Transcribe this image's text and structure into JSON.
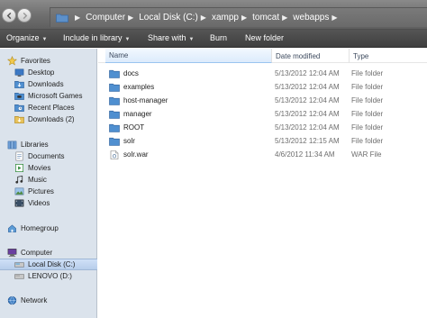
{
  "address_bar": {
    "breadcrumbs": [
      "Computer",
      "Local Disk (C:)",
      "xampp",
      "tomcat",
      "webapps"
    ]
  },
  "command_bar": {
    "organize": "Organize",
    "include_in_library": "Include in library",
    "share_with": "Share with",
    "burn": "Burn",
    "new_folder": "New folder"
  },
  "nav": {
    "favorites": {
      "label": "Favorites",
      "items": [
        "Desktop",
        "Downloads",
        "Microsoft Games",
        "Recent Places",
        "Downloads (2)"
      ]
    },
    "libraries": {
      "label": "Libraries",
      "items": [
        "Documents",
        "Movies",
        "Music",
        "Pictures",
        "Videos"
      ]
    },
    "homegroup": "Homegroup",
    "computer": {
      "label": "Computer",
      "items": [
        "Local Disk (C:)",
        "LENOVO (D:)"
      ],
      "selected": "Local Disk (C:)"
    },
    "network": "Network"
  },
  "columns": {
    "name": "Name",
    "date": "Date modified",
    "type": "Type",
    "sorted": "Name"
  },
  "files": [
    {
      "name": "docs",
      "date": "5/13/2012 12:04 AM",
      "type": "File folder",
      "icon": "folder-icon"
    },
    {
      "name": "examples",
      "date": "5/13/2012 12:04 AM",
      "type": "File folder",
      "icon": "folder-icon"
    },
    {
      "name": "host-manager",
      "date": "5/13/2012 12:04 AM",
      "type": "File folder",
      "icon": "folder-icon"
    },
    {
      "name": "manager",
      "date": "5/13/2012 12:04 AM",
      "type": "File folder",
      "icon": "folder-icon"
    },
    {
      "name": "ROOT",
      "date": "5/13/2012 12:04 AM",
      "type": "File folder",
      "icon": "folder-icon"
    },
    {
      "name": "solr",
      "date": "5/13/2012 12:15 AM",
      "type": "File folder",
      "icon": "folder-icon"
    },
    {
      "name": "solr.war",
      "date": "4/6/2012 11:34 AM",
      "type": "WAR File",
      "icon": "war-file-icon"
    }
  ],
  "colors": {
    "selection": "#b7cdea",
    "sorted_header": "#dcebfc",
    "nav_background": "#dbe3ec",
    "folder": "#4f8fd0"
  }
}
